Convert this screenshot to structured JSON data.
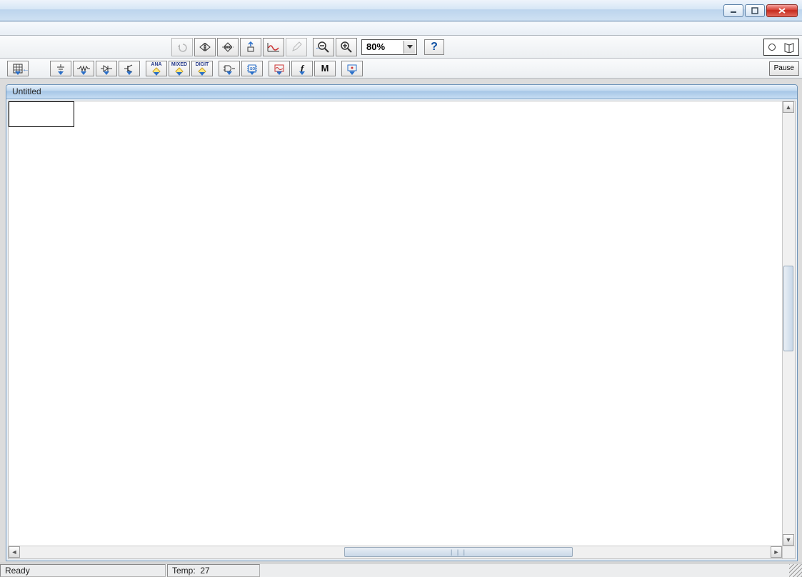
{
  "window": {
    "title": ""
  },
  "toolbar1": {
    "buttons": {
      "undo": "undo",
      "mirror_h": "mirror-horizontal",
      "mirror_v": "mirror-vertical",
      "rotate": "rotate",
      "graph": "graph",
      "edit": "edit",
      "zoom_out": "zoom-out",
      "zoom_in": "zoom-in"
    },
    "zoom_value": "80%",
    "help": "?"
  },
  "toolbar2": {
    "buttons": [
      {
        "name": "grid",
        "label": ""
      },
      {
        "name": "ground",
        "label": ""
      },
      {
        "name": "resistor",
        "label": ""
      },
      {
        "name": "diode",
        "label": ""
      },
      {
        "name": "transistor",
        "label": ""
      },
      {
        "name": "analog-primitives",
        "label": "ANA"
      },
      {
        "name": "mixed-primitives",
        "label": "MIXED"
      },
      {
        "name": "digital-primitives",
        "label": "DIGIT"
      },
      {
        "name": "gate",
        "label": ""
      },
      {
        "name": "ic",
        "label": ""
      },
      {
        "name": "scope",
        "label": ""
      },
      {
        "name": "function",
        "label": "f"
      },
      {
        "name": "macro",
        "label": "M"
      },
      {
        "name": "display",
        "label": ""
      }
    ],
    "pause_label": "Pause"
  },
  "document": {
    "title": "Untitled"
  },
  "statusbar": {
    "ready": "Ready",
    "temp_label": "Temp:",
    "temp_value": "27"
  }
}
